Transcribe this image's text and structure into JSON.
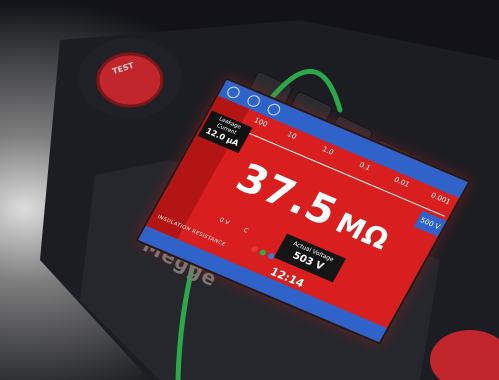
{
  "buttons": {
    "red_knob": "TEST"
  },
  "brand": {
    "text": "Megge"
  },
  "screen": {
    "scale_ticks": [
      "100",
      "10",
      "1.0",
      "0.1",
      "0.01",
      "0.001"
    ],
    "leakage": {
      "label": "Leakage Current",
      "value": "12.0 µA"
    },
    "reading": {
      "value": "37.5",
      "unit": "MΩ"
    },
    "test_voltage": "500 V",
    "actual_voltage": {
      "label": "Actual Voltage",
      "value": "503 V"
    },
    "time": "12:14",
    "mode_label": "INSULATION RESISTANCE",
    "small_labels": [
      "0 V",
      "C"
    ]
  },
  "colors": {
    "screen_red": "#d81e1e",
    "bar_blue": "#2f63c9",
    "cable_green": "#2aa84a",
    "knob_red": "#c0262b"
  }
}
